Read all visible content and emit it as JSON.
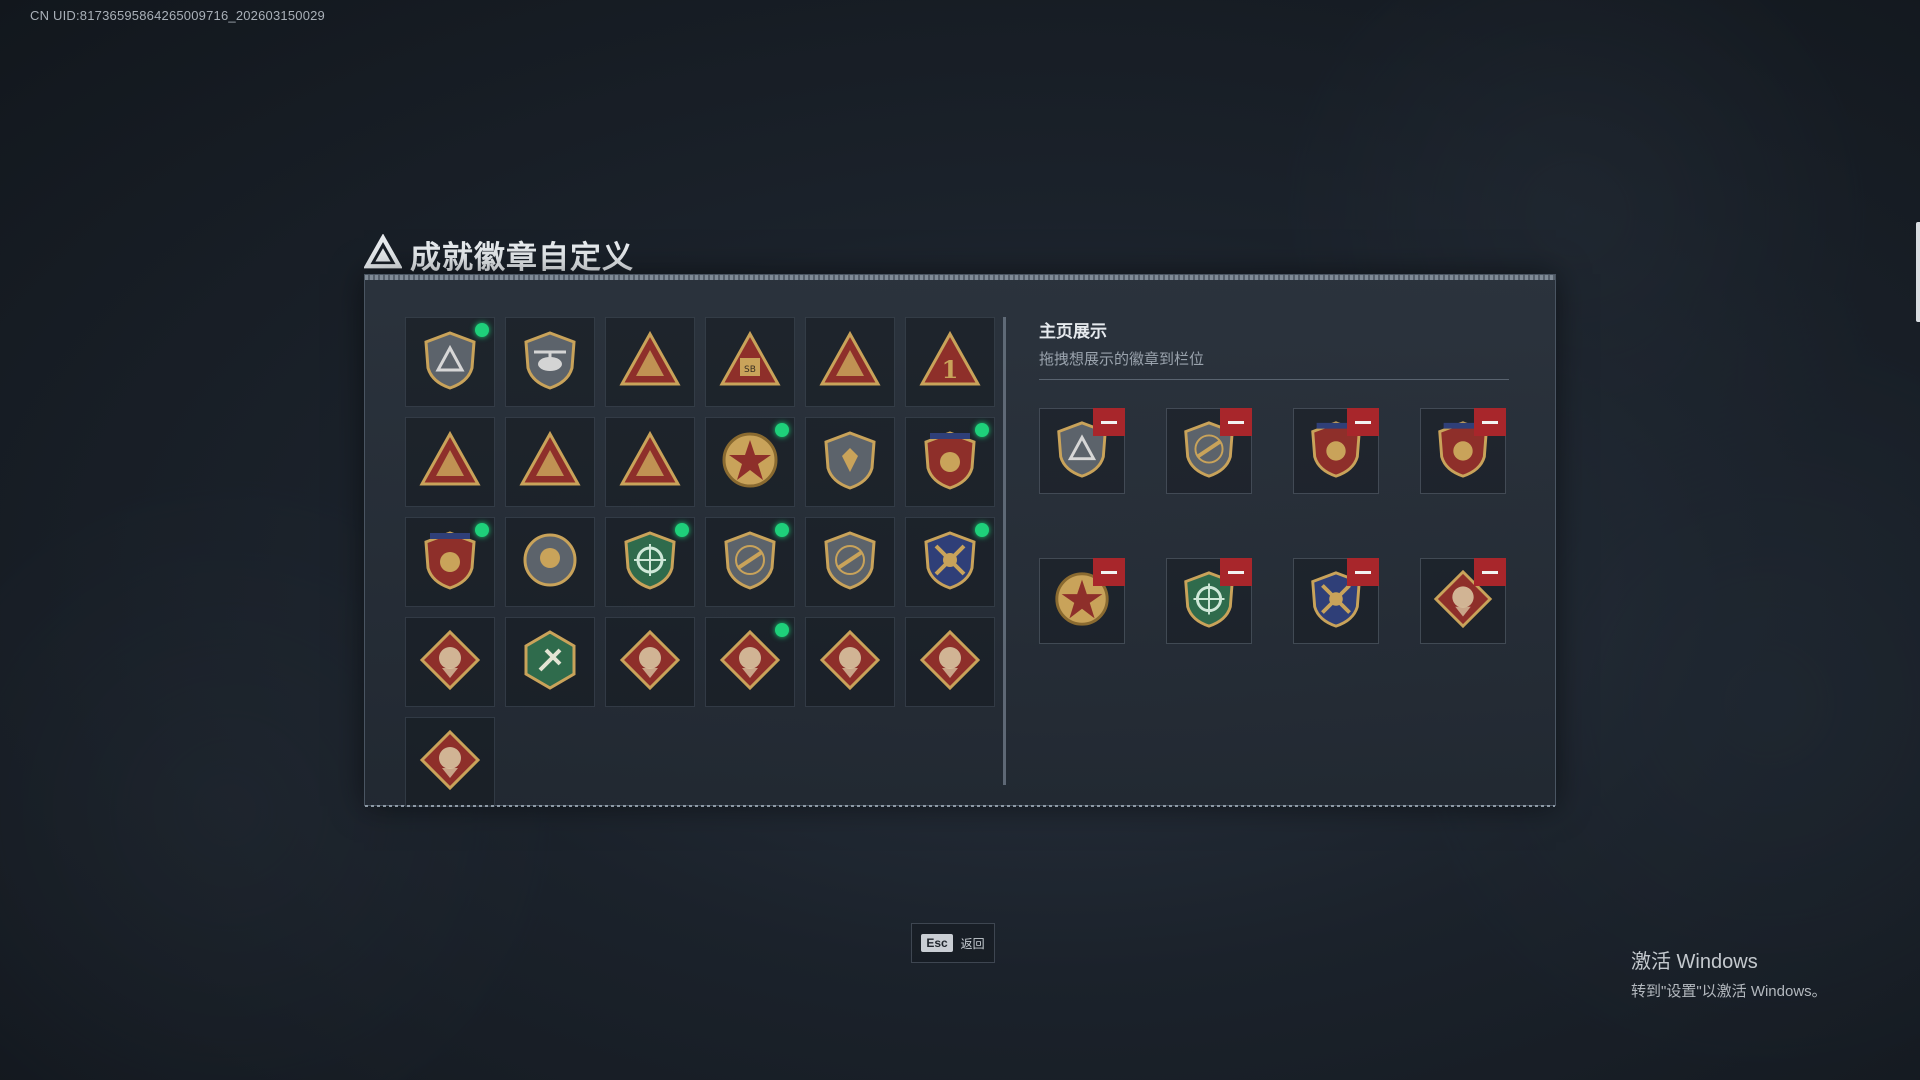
{
  "uid": "CN UID:81736595864265009716_202603150029",
  "page": {
    "title": "成就徽章自定义"
  },
  "display": {
    "title": "主页展示",
    "subtitle": "拖拽想展示的徽章到栏位"
  },
  "footer": {
    "esc_key": "Esc",
    "esc_label": "返回"
  },
  "watermark": {
    "line1": "激活 Windows",
    "line2": "转到\"设置\"以激活 Windows。"
  },
  "colors": {
    "equipped_dot": "#1ed07a",
    "remove_button": "#a8262b"
  },
  "badges": [
    {
      "icon": "shield-triangle-badge-icon",
      "equipped": true
    },
    {
      "icon": "helicopter-badge-icon",
      "equipped": false
    },
    {
      "icon": "tower-triangle-badge-icon",
      "equipped": false
    },
    {
      "icon": "sb-triangle-badge-icon",
      "equipped": false
    },
    {
      "icon": "ship-triangle-badge-icon",
      "equipped": false
    },
    {
      "icon": "number-one-triangle-badge-icon",
      "equipped": false
    },
    {
      "icon": "crate-triangle-badge-icon",
      "equipped": false
    },
    {
      "icon": "soldier-triangle-badge-icon",
      "equipped": false
    },
    {
      "icon": "rocket-triangle-badge-icon",
      "equipped": false
    },
    {
      "icon": "star-medal-badge-icon",
      "equipped": true
    },
    {
      "icon": "plain-shield-badge-icon",
      "equipped": false
    },
    {
      "icon": "starred-crest-badge-icon",
      "equipped": true
    },
    {
      "icon": "starred-crest-gold-badge-icon",
      "equipped": true
    },
    {
      "icon": "round-emblem-badge-icon",
      "equipped": false
    },
    {
      "icon": "green-crosshair-badge-icon",
      "equipped": true
    },
    {
      "icon": "gun-shield-badge-icon",
      "equipped": true
    },
    {
      "icon": "gun-shield-plain-badge-icon",
      "equipped": false
    },
    {
      "icon": "crossed-weapons-gold-badge-icon",
      "equipped": true
    },
    {
      "icon": "wolf-diamond-badge-icon",
      "equipped": false
    },
    {
      "icon": "green-hex-badge-icon",
      "equipped": false
    },
    {
      "icon": "dragon-diamond-badge-icon",
      "equipped": false
    },
    {
      "icon": "dragon-diamond-alt-badge-icon",
      "equipped": true
    },
    {
      "icon": "runner-diamond-badge-icon",
      "equipped": false
    },
    {
      "icon": "horse-diamond-badge-icon",
      "equipped": false
    },
    {
      "icon": "tool-diamond-badge-icon",
      "equipped": false
    }
  ],
  "displayed": [
    {
      "icon": "shield-triangle-badge-icon"
    },
    {
      "icon": "gun-shield-badge-icon"
    },
    {
      "icon": "starred-crest-badge-icon"
    },
    {
      "icon": "starred-crest-gold-badge-icon"
    },
    {
      "icon": "star-medal-badge-icon"
    },
    {
      "icon": "green-crosshair-badge-icon"
    },
    {
      "icon": "crossed-weapons-gold-badge-icon"
    },
    {
      "icon": "dragon-diamond-alt-badge-icon"
    }
  ]
}
